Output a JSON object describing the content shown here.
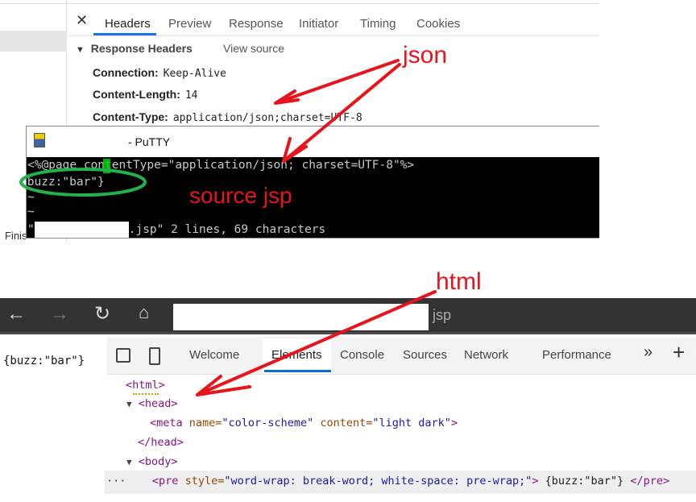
{
  "network_panel": {
    "tabs": [
      {
        "label": "Headers",
        "active": true
      },
      {
        "label": "Preview"
      },
      {
        "label": "Response"
      },
      {
        "label": "Initiator"
      },
      {
        "label": "Timing"
      },
      {
        "label": "Cookies"
      }
    ],
    "section_title": "Response Headers",
    "view_source": "View source",
    "headers": [
      {
        "name": "Connection:",
        "value": "Keep-Alive"
      },
      {
        "name": "Content-Length:",
        "value": "14"
      },
      {
        "name": "Content-Type:",
        "value": "application/json;charset=UTF-8"
      }
    ],
    "status_partial": "Finis"
  },
  "putty": {
    "title": "- PuTTY",
    "lines": [
      "<%@page contentType=\"application/json; charset=UTF-8\"%>",
      "{buzz:\"bar\"}",
      "~",
      "~"
    ],
    "status_line": "\"         .jsp\" 2 lines, 69 characters",
    "status_suffix": ".jsp\" 2 lines, 69 characters"
  },
  "browser": {
    "url_suffix": "jsp",
    "page_text": "{buzz:\"bar\"}",
    "devtools_tabs": [
      {
        "label": "Welcome"
      },
      {
        "label": "Elements",
        "active": true
      },
      {
        "label": "Console"
      },
      {
        "label": "Sources"
      },
      {
        "label": "Network"
      },
      {
        "label": "Performance"
      }
    ],
    "more": "»",
    "add": "+",
    "dom": {
      "html": "<html>",
      "head": "<head>",
      "meta_tag": "<meta",
      "meta_name_attr": "name=",
      "meta_name_val": "\"color-scheme\"",
      "meta_content_attr": "content=",
      "meta_content_val": "\"light dark\"",
      "meta_close": ">",
      "head_close": "</head>",
      "body": "<body>",
      "pre_open": "<pre",
      "pre_style_attr": "style=",
      "pre_style_val": "\"word-wrap: break-word; white-space: pre-wrap;\"",
      "pre_gt": ">",
      "pre_text": "{buzz:\"bar\"}",
      "pre_close": "</pre>",
      "ellipsis": "···"
    }
  },
  "annotations": {
    "json": "json",
    "source_jsp": "source jsp",
    "html": "html",
    "arrow_color": "#e8141c",
    "circle_color": "#22b14c"
  }
}
